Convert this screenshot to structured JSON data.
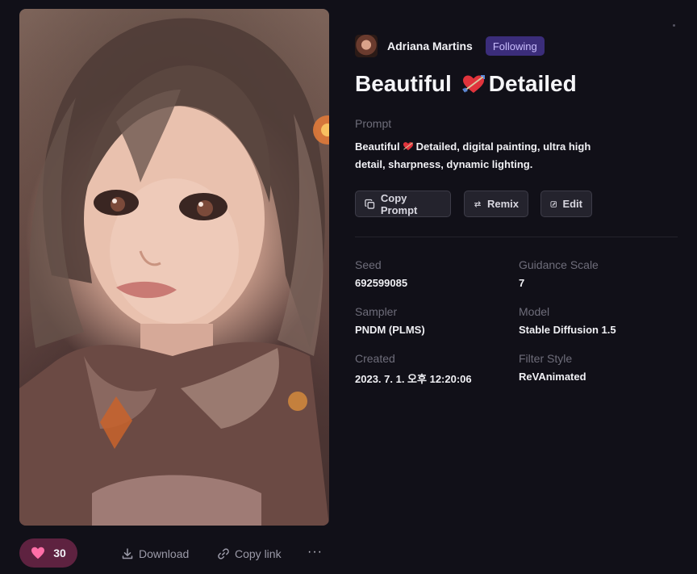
{
  "artwork": {
    "alt_icon": "portrait-artwork-image"
  },
  "actions": {
    "like_count": "30",
    "download_label": "Download",
    "copy_link_label": "Copy link",
    "more_label": "···"
  },
  "author": {
    "name": "Adriana Martins",
    "follow_status": "Following"
  },
  "title": {
    "left": "Beautiful",
    "right": "Detailed",
    "emoji": "heart-with-arrow-icon"
  },
  "prompt": {
    "label": "Prompt",
    "text_start": "Beautiful",
    "text_rest": "Detailed, digital painting, ultra high detail, sharpness, dynamic lighting."
  },
  "buttons": {
    "copy_prompt": "Copy Prompt",
    "remix": "Remix",
    "edit": "Edit"
  },
  "details": {
    "seed_label": "Seed",
    "seed": "692599085",
    "guidance_label": "Guidance Scale",
    "guidance": "7",
    "sampler_label": "Sampler",
    "sampler": "PNDM (PLMS)",
    "model_label": "Model",
    "model": "Stable Diffusion 1.5",
    "created_label": "Created",
    "created": "2023. 7. 1. 오후 12:20:06",
    "filter_label": "Filter Style",
    "filter": "ReVAnimated"
  },
  "colors": {
    "background": "#111018",
    "like_pill": "#5e2240",
    "heart": "#ff6fa8",
    "follow_badge": "#3b2d7a",
    "follow_text": "#c9bdfd",
    "muted_text": "#6e6d7a"
  }
}
